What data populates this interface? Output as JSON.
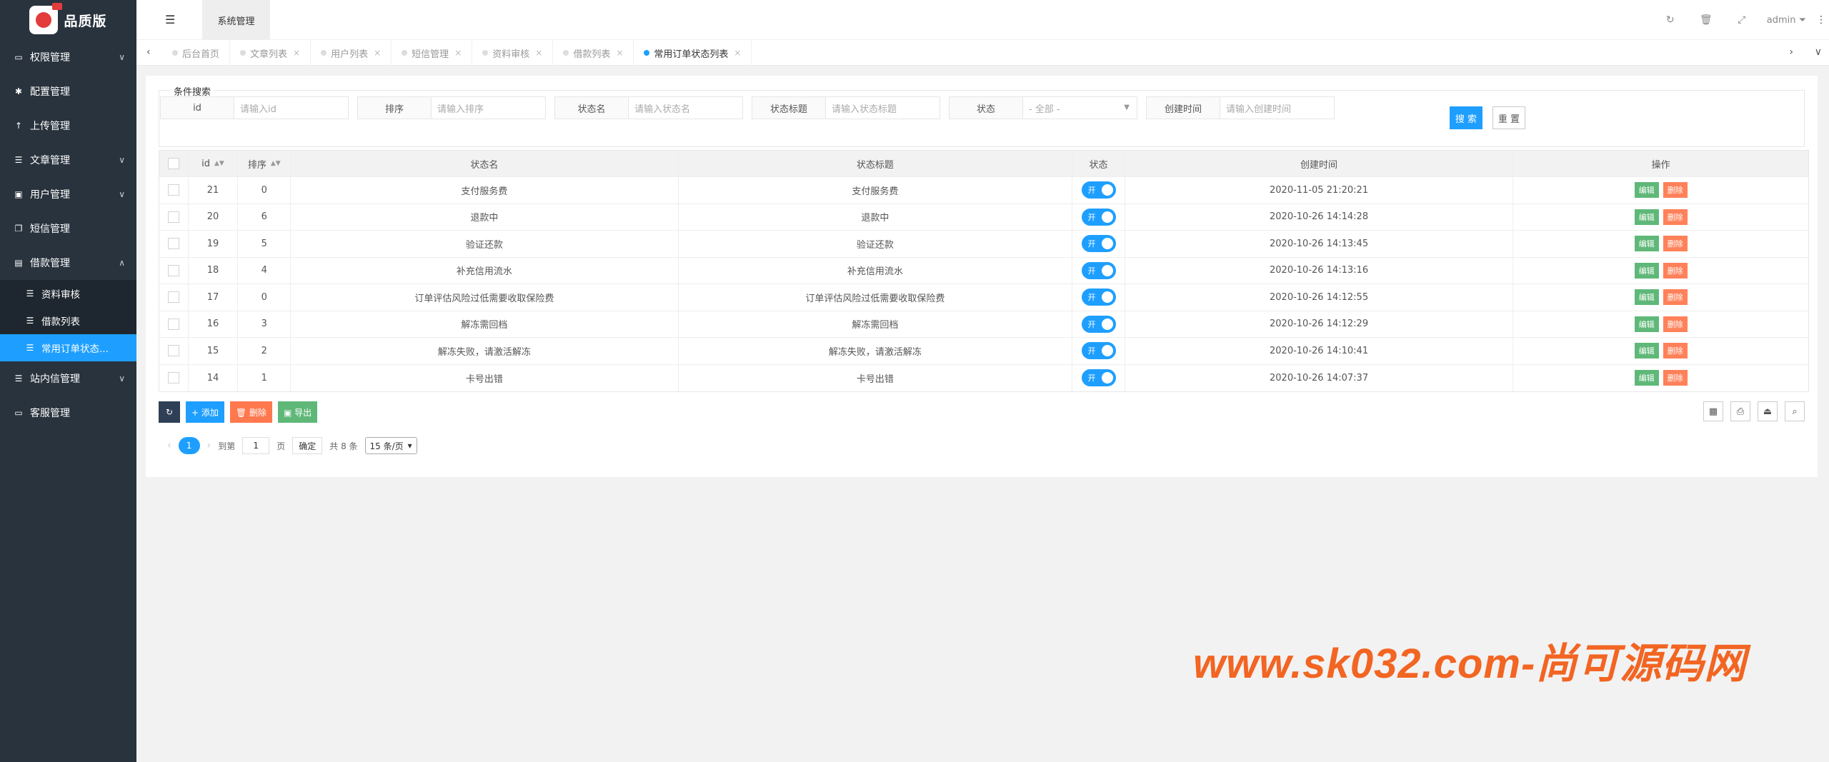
{
  "brand": {
    "name": "品质版"
  },
  "sidebar": {
    "items": [
      {
        "label": "权限管理",
        "icon": "monitor-icon",
        "glyph": "▭",
        "chevron": "∨"
      },
      {
        "label": "配置管理",
        "icon": "asterisk-icon",
        "glyph": "✱",
        "chevron": ""
      },
      {
        "label": "上传管理",
        "icon": "arrow-up-icon",
        "glyph": "↑",
        "chevron": ""
      },
      {
        "label": "文章管理",
        "icon": "list-icon",
        "glyph": "☰",
        "chevron": "∨"
      },
      {
        "label": "用户管理",
        "icon": "user-card-icon",
        "glyph": "▣",
        "chevron": "∨"
      },
      {
        "label": "短信管理",
        "icon": "copy-icon",
        "glyph": "❐",
        "chevron": ""
      },
      {
        "label": "借款管理",
        "icon": "money-icon",
        "glyph": "▤",
        "chevron": "∧"
      }
    ],
    "subitems": [
      {
        "label": "资料审核",
        "glyph": "☰"
      },
      {
        "label": "借款列表",
        "glyph": "☰"
      },
      {
        "label": "常用订单状态...",
        "glyph": "☰"
      }
    ],
    "items_after": [
      {
        "label": "站内信管理",
        "icon": "list-icon",
        "glyph": "☰",
        "chevron": "∨"
      },
      {
        "label": "客服管理",
        "icon": "desktop-icon",
        "glyph": "▭",
        "chevron": ""
      }
    ]
  },
  "header": {
    "menu_glyph": "☰",
    "top_tab": "系统管理",
    "user": "admin ⏷",
    "icons": {
      "refresh": "↻",
      "trash": "🗑",
      "fullscreen": "⤢",
      "more": "⋮"
    }
  },
  "tabbar": {
    "left": "‹",
    "right": "›",
    "down": "∨",
    "close": "×",
    "tabs": [
      {
        "label": "后台首页"
      },
      {
        "label": "文章列表"
      },
      {
        "label": "用户列表"
      },
      {
        "label": "短信管理"
      },
      {
        "label": "资料审核"
      },
      {
        "label": "借款列表"
      },
      {
        "label": "常用订单状态列表"
      }
    ]
  },
  "search": {
    "legend": "条件搜索",
    "fields": [
      {
        "label": "id",
        "placeholder": "请输入id"
      },
      {
        "label": "排序",
        "placeholder": "请输入排序"
      },
      {
        "label": "状态名",
        "placeholder": "请输入状态名"
      },
      {
        "label": "状态标题",
        "placeholder": "请输入状态标题"
      },
      {
        "label": "状态",
        "placeholder": "- 全部 -"
      },
      {
        "label": "创建时间",
        "placeholder": "请输入创建时间"
      }
    ],
    "search_btn": "搜 索",
    "reset_btn": "重 置",
    "caret": "▼"
  },
  "table": {
    "columns": [
      "id",
      "排序",
      "状态名",
      "状态标题",
      "状态",
      "创建时间",
      "操作"
    ],
    "sort_glyph": "▲▼",
    "switch_label": "开",
    "edit_label": "编辑",
    "delete_label": "删除",
    "rows": [
      {
        "id": "21",
        "sort": "0",
        "name": "支付服务费",
        "title": "支付服务费",
        "time": "2020-11-05 21:20:21"
      },
      {
        "id": "20",
        "sort": "6",
        "name": "退款中",
        "title": "退款中",
        "time": "2020-10-26 14:14:28"
      },
      {
        "id": "19",
        "sort": "5",
        "name": "验证还款",
        "title": "验证还款",
        "time": "2020-10-26 14:13:45"
      },
      {
        "id": "18",
        "sort": "4",
        "name": "补充信用流水",
        "title": "补充信用流水",
        "time": "2020-10-26 14:13:16"
      },
      {
        "id": "17",
        "sort": "0",
        "name": "订单评估风险过低需要收取保险费",
        "title": "订单评估风险过低需要收取保险费",
        "time": "2020-10-26 14:12:55"
      },
      {
        "id": "16",
        "sort": "3",
        "name": "解冻需回档",
        "title": "解冻需回档",
        "time": "2020-10-26 14:12:29"
      },
      {
        "id": "15",
        "sort": "2",
        "name": "解冻失败，请激活解冻",
        "title": "解冻失败，请激活解冻",
        "time": "2020-10-26 14:10:41"
      },
      {
        "id": "14",
        "sort": "1",
        "name": "卡号出错",
        "title": "卡号出错",
        "time": "2020-10-26 14:07:37"
      }
    ]
  },
  "toolbar": {
    "refresh": "↻",
    "add": "+ 添加",
    "delete": "🗑 删除",
    "export": "▣ 导出",
    "tools": [
      "▦",
      "⎙",
      "⏏",
      "⌕"
    ]
  },
  "pager": {
    "prev": "‹",
    "current": "1",
    "next": "›",
    "goto": "到第",
    "page_value": "1",
    "page_unit": "页",
    "confirm": "确定",
    "total": "共 8 条",
    "per_page": "15 条/页",
    "per_page_caret": "▾"
  },
  "watermark": "www.sk032.com-尚可源码网"
}
